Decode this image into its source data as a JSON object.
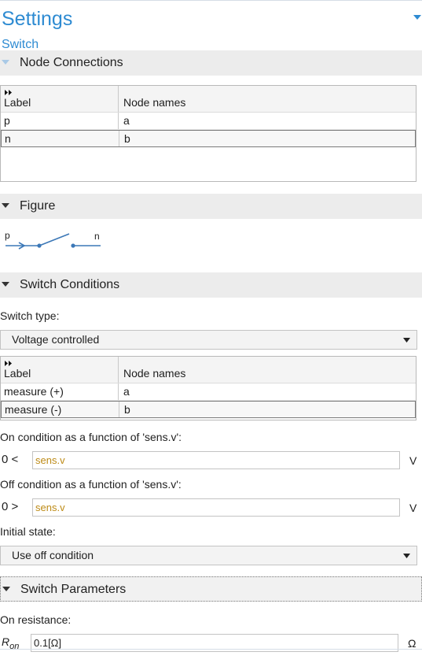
{
  "header": {
    "title": "Settings",
    "subtitle": "Switch"
  },
  "node_connections": {
    "section_title": "Node Connections",
    "columns": [
      "Label",
      "Node names"
    ],
    "rows": [
      {
        "label": "p",
        "node": "a"
      },
      {
        "label": "n",
        "node": "b"
      }
    ]
  },
  "figure": {
    "section_title": "Figure",
    "label_p": "p",
    "label_n": "n"
  },
  "switch_conditions": {
    "section_title": "Switch Conditions",
    "switch_type_label": "Switch type:",
    "switch_type_value": "Voltage controlled",
    "columns": [
      "Label",
      "Node names"
    ],
    "rows": [
      {
        "label": "measure (+)",
        "node": "a"
      },
      {
        "label": "measure (-)",
        "node": "b"
      }
    ],
    "on_condition_label": "On condition as a function of 'sens.v':",
    "on_prefix": "0 <",
    "on_value": "sens.v",
    "on_unit": "V",
    "off_condition_label": "Off condition as a function of 'sens.v':",
    "off_prefix": "0 >",
    "off_value": "sens.v",
    "off_unit": "V",
    "initial_state_label": "Initial state:",
    "initial_state_value": "Use off condition"
  },
  "switch_parameters": {
    "section_title": "Switch Parameters",
    "on_resistance_label": "On resistance:",
    "ron_symbol": "R",
    "ron_sub": "on",
    "ron_value": "0.1[Ω]",
    "ron_unit": "Ω"
  },
  "colors": {
    "accent": "#2e8bd2",
    "expression": "#bd8b17",
    "section_bg": "#ececec"
  }
}
